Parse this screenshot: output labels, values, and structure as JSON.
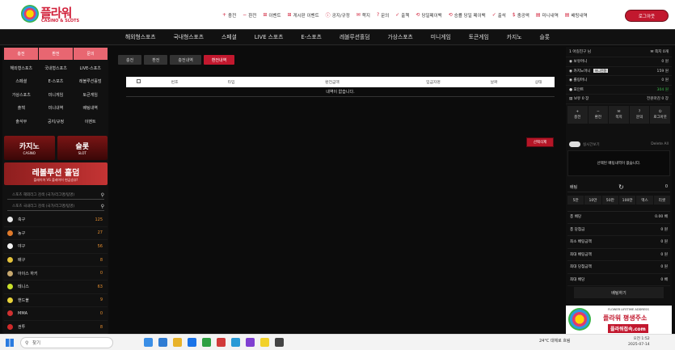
{
  "logo": {
    "name": "플라워",
    "sub": "CASINO & SLOTS"
  },
  "top_menu": [
    "충전",
    "환전",
    "이벤트",
    "게시판 이벤트",
    "공지/규정",
    "쪽지",
    "문의",
    "출첵",
    "당일페이백",
    "승률 당일 페이백",
    "출석",
    "충공액",
    "미니내역",
    "배팅내역"
  ],
  "logout": "로그아웃",
  "main_nav": [
    "해외형스포츠",
    "국내형스포츠",
    "스페셜",
    "LIVE 스포츠",
    "E-스포츠",
    "레볼루션홀덤",
    "가상스포츠",
    "미니게임",
    "토큰게임",
    "카지노",
    "슬롯"
  ],
  "left": {
    "tabs": [
      "충전",
      "환전",
      "문의"
    ],
    "grid": [
      [
        "해외형스포츠",
        "국내형스포츠",
        "LIVE-스포츠"
      ],
      [
        "스페셜",
        "E-스포츠",
        "레볼루션홀덤"
      ],
      [
        "가상스포츠",
        "미니게임",
        "토큰게임"
      ],
      [
        "출첵",
        "미니내역",
        "배팅내역"
      ],
      [
        "출석부",
        "공지/규정",
        "이벤트"
      ]
    ],
    "banner_casino": "카지노",
    "banner_casino_sub": "CASINO",
    "banner_slot": "슬롯",
    "banner_slot_sub": "SLOT",
    "banner_holdem": "레볼루션 홀덤",
    "banner_holdem_sub": "플레이어 VS 플레이어 현금승부!",
    "search1": "스포츠 해외리그 검색 (국가/리그명/팀명)",
    "search2": "스포츠 국내리그 검색 (국가/리그명/팀명)",
    "sports": [
      {
        "label": "축구",
        "count": "125",
        "color": "#e8e8e8"
      },
      {
        "label": "농구",
        "count": "27",
        "color": "#e07a2a"
      },
      {
        "label": "야구",
        "count": "56",
        "color": "#f2f2f2"
      },
      {
        "label": "배구",
        "count": "8",
        "color": "#e3c23b"
      },
      {
        "label": "아이스 하키",
        "count": "0",
        "color": "#c7a86e"
      },
      {
        "label": "테니스",
        "count": "63",
        "color": "#c9e02a"
      },
      {
        "label": "핸드볼",
        "count": "9",
        "color": "#e8d23a"
      },
      {
        "label": "MMA",
        "count": "0",
        "color": "#d03030"
      },
      {
        "label": "권투",
        "count": "8",
        "color": "#d02a2a"
      }
    ]
  },
  "center": {
    "tabs": [
      "충전",
      "환전",
      "충전내역",
      "환전내역"
    ],
    "active_tab": "환전내역",
    "columns": [
      "번호",
      "타입",
      "환전금액",
      "입금자명",
      "날짜",
      "상태"
    ],
    "empty": "내역이 없습니다.",
    "delete": "선택삭제"
  },
  "right": {
    "user": "1 아길친구 님",
    "msg": "쪽지 0개",
    "rows": [
      {
        "label": "보유머니",
        "value": "0 원"
      },
      {
        "label": "카지노머니",
        "badge": "머니전환",
        "value": "159 원"
      },
      {
        "label": "롤링머니",
        "value": "0 원"
      },
      {
        "label": "포인트",
        "value": "304 원"
      },
      {
        "label": "보유 0 장",
        "value": "전원마감 0 장"
      }
    ],
    "actions": [
      "충전",
      "환전",
      "쪽지",
      "문의",
      "로그아웃"
    ],
    "toggle_label": "실시간보기",
    "toggle_right": "Delete All",
    "slip_empty": "선택된 배팅내역이 없습니다.",
    "bet_title": "배팅",
    "bet_count": "0",
    "amounts": [
      "5만",
      "10만",
      "50만",
      "100만",
      "맥스",
      "리셋"
    ],
    "sums": [
      {
        "label": "총 배당",
        "value": "0.00 배"
      },
      {
        "label": "총 당첨금",
        "value": "0 원"
      },
      {
        "label": "최소 배팅금액",
        "value": "0 원"
      },
      {
        "label": "최대 배팅금액",
        "value": "0 원"
      },
      {
        "label": "최대 당첨금액",
        "value": "0 원"
      },
      {
        "label": "최대 배당",
        "value": "0 배"
      }
    ],
    "bet_button": "배팅하기",
    "ad_line1": "FLOWER LIFETIME ADDRESS",
    "ad_line2": "플라워 평생주소",
    "ad_line3": "플라워접속.com"
  },
  "taskbar": {
    "search": "찾기",
    "weather": "24°C 대체로 흐림",
    "time": "오전 1:52",
    "date": "2025-07-14"
  }
}
